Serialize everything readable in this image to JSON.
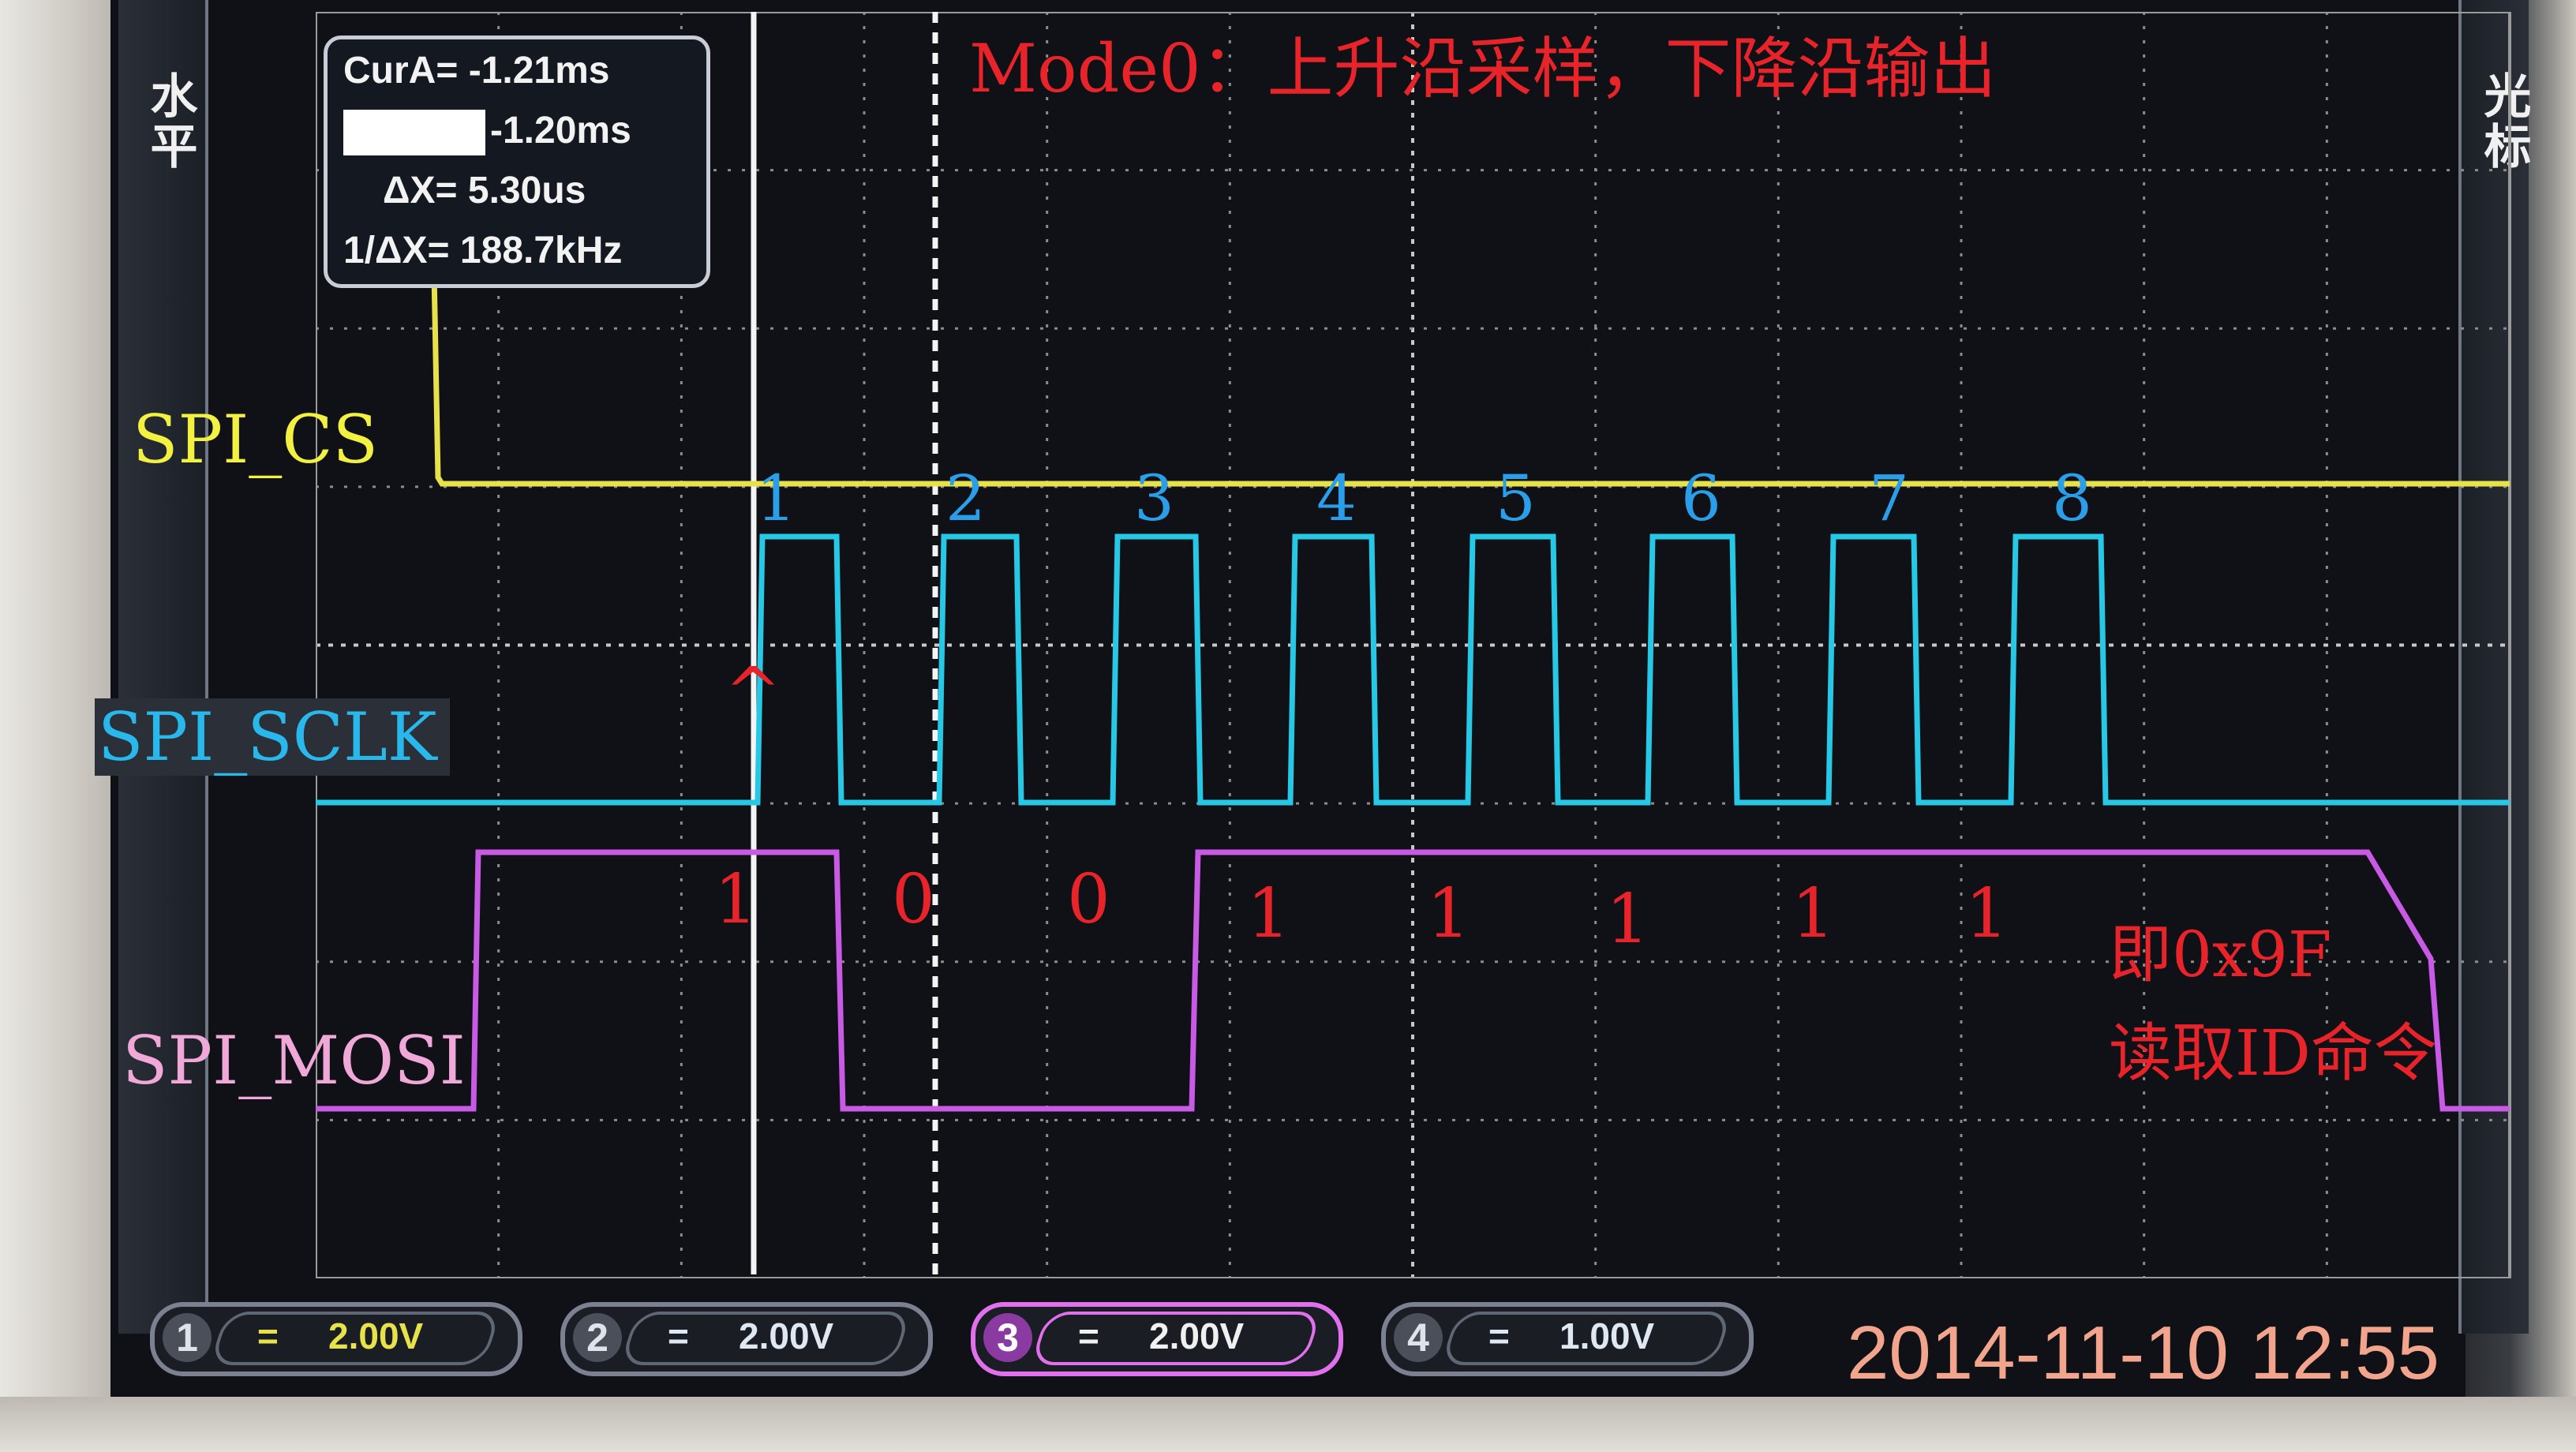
{
  "side_panels": {
    "left_label": "水平",
    "right_label": "光标"
  },
  "cursor_readout": {
    "cur_a_label": "CurA=",
    "cur_a_value": "-1.21ms",
    "cur_b_value": "-1.20ms",
    "delta_x_label": "ΔX=",
    "delta_x_value": "5.30us",
    "inv_delta_x_label": "1/ΔX=",
    "inv_delta_x_value": "188.7kHz"
  },
  "annotations": {
    "mode_title": "Mode0：上升沿采样，下降沿输出",
    "rising_edge_marker": "^",
    "result_line1": "即0x9F",
    "result_line2": "读取ID命令"
  },
  "signals": [
    {
      "name": "SPI_CS",
      "color": "#e8e24a",
      "label_color": "#f2f040"
    },
    {
      "name": "SPI_SCLK",
      "color": "#27c8e6",
      "label_color": "#29b8ec"
    },
    {
      "name": "SPI_MOSI",
      "color": "#c85ae6",
      "label_color": "#f0a8d8"
    }
  ],
  "clock_numbers": [
    "1",
    "2",
    "3",
    "4",
    "5",
    "6",
    "7",
    "8"
  ],
  "mosi_bits": [
    "1",
    "0",
    "0",
    "1",
    "1",
    "1",
    "1",
    "1"
  ],
  "channels": [
    {
      "num": "1",
      "coupling": "=",
      "volts": "2.00V",
      "color": "#e8e24a"
    },
    {
      "num": "2",
      "coupling": "=",
      "volts": "2.00V",
      "color": "#dfe8f2"
    },
    {
      "num": "3",
      "coupling": "=",
      "volts": "2.00V",
      "color": "#e070ec"
    },
    {
      "num": "4",
      "coupling": "=",
      "volts": "1.00V",
      "color": "#dfe8f2"
    }
  ],
  "timestamp": "2014-11-10 12:55",
  "colors": {
    "annotation_red": "#e8242a",
    "clock_number_blue": "#2a9ee8",
    "grid": "#8c8c8c"
  }
}
